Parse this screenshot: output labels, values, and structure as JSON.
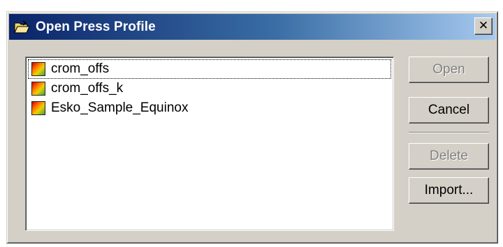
{
  "window": {
    "title": "Open Press Profile",
    "close_glyph": "✕",
    "title_icon": "open-folder-icon"
  },
  "profiles": {
    "items": [
      {
        "label": "crom_offs",
        "icon": "press-profile-icon",
        "focused": true
      },
      {
        "label": "crom_offs_k",
        "icon": "press-profile-icon",
        "focused": false
      },
      {
        "label": "Esko_Sample_Equinox",
        "icon": "press-profile-icon",
        "focused": false
      }
    ]
  },
  "buttons": {
    "open": {
      "label": "Open",
      "enabled": false
    },
    "cancel": {
      "label": "Cancel",
      "enabled": true
    },
    "delete": {
      "label": "Delete",
      "enabled": false
    },
    "import": {
      "label": "Import...",
      "enabled": true
    }
  },
  "colors": {
    "titlebar_start": "#0a246a",
    "titlebar_end": "#a6caf0",
    "dialog_face": "#d4d0c8",
    "disabled_text": "#808080"
  }
}
